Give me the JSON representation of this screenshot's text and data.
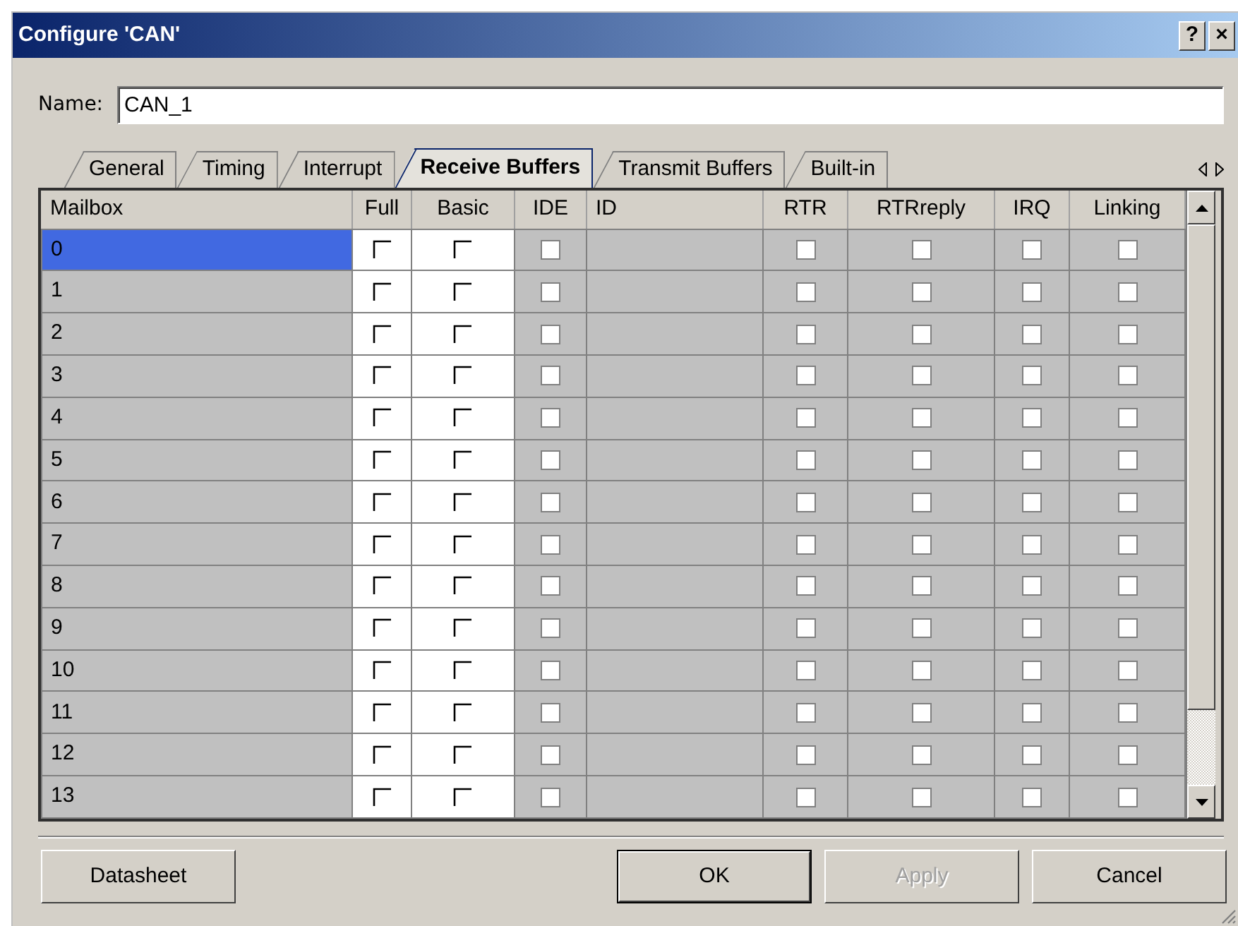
{
  "window": {
    "title": "Configure 'CAN'",
    "help_button": "?",
    "close_button": "×"
  },
  "name_field": {
    "label": "Name:",
    "value": "CAN_1"
  },
  "tabs": [
    {
      "label": "General",
      "selected": false
    },
    {
      "label": "Timing",
      "selected": false
    },
    {
      "label": "Interrupt",
      "selected": false
    },
    {
      "label": "Receive Buffers",
      "selected": true
    },
    {
      "label": "Transmit Buffers",
      "selected": false
    },
    {
      "label": "Built-in",
      "selected": false
    }
  ],
  "table": {
    "columns": [
      {
        "label": "Mailbox",
        "kind": "name"
      },
      {
        "label": "Full",
        "kind": "check",
        "enabled": true
      },
      {
        "label": "Basic",
        "kind": "check",
        "enabled": true
      },
      {
        "label": "IDE",
        "kind": "check",
        "enabled": false
      },
      {
        "label": "ID",
        "kind": "value"
      },
      {
        "label": "RTR",
        "kind": "check",
        "enabled": false
      },
      {
        "label": "RTRreply",
        "kind": "check",
        "enabled": false
      },
      {
        "label": "IRQ",
        "kind": "check",
        "enabled": false
      },
      {
        "label": "Linking",
        "kind": "check",
        "enabled": false
      }
    ],
    "rows": [
      {
        "mailbox": "0",
        "selected": true,
        "checked": [
          false,
          false,
          false,
          false,
          false,
          false,
          false
        ]
      },
      {
        "mailbox": "1",
        "selected": false,
        "checked": [
          false,
          false,
          false,
          false,
          false,
          false,
          false
        ]
      },
      {
        "mailbox": "2",
        "selected": false,
        "checked": [
          false,
          false,
          false,
          false,
          false,
          false,
          false
        ]
      },
      {
        "mailbox": "3",
        "selected": false,
        "checked": [
          false,
          false,
          false,
          false,
          false,
          false,
          false
        ]
      },
      {
        "mailbox": "4",
        "selected": false,
        "checked": [
          false,
          false,
          false,
          false,
          false,
          false,
          false
        ]
      },
      {
        "mailbox": "5",
        "selected": false,
        "checked": [
          false,
          false,
          false,
          false,
          false,
          false,
          false
        ]
      },
      {
        "mailbox": "6",
        "selected": false,
        "checked": [
          false,
          false,
          false,
          false,
          false,
          false,
          false
        ]
      },
      {
        "mailbox": "7",
        "selected": false,
        "checked": [
          false,
          false,
          false,
          false,
          false,
          false,
          false
        ]
      },
      {
        "mailbox": "8",
        "selected": false,
        "checked": [
          false,
          false,
          false,
          false,
          false,
          false,
          false
        ]
      },
      {
        "mailbox": "9",
        "selected": false,
        "checked": [
          false,
          false,
          false,
          false,
          false,
          false,
          false
        ]
      },
      {
        "mailbox": "10",
        "selected": false,
        "checked": [
          false,
          false,
          false,
          false,
          false,
          false,
          false
        ]
      },
      {
        "mailbox": "11",
        "selected": false,
        "checked": [
          false,
          false,
          false,
          false,
          false,
          false,
          false
        ]
      },
      {
        "mailbox": "12",
        "selected": false,
        "checked": [
          false,
          false,
          false,
          false,
          false,
          false,
          false
        ]
      },
      {
        "mailbox": "13",
        "selected": false,
        "checked": [
          false,
          false,
          false,
          false,
          false,
          false,
          false
        ]
      }
    ]
  },
  "buttons": [
    {
      "label": "Datasheet",
      "kind": "left",
      "disabled": false,
      "default": false
    },
    {
      "label": "OK",
      "kind": "right",
      "disabled": false,
      "default": true
    },
    {
      "label": "Apply",
      "kind": "right",
      "disabled": true,
      "default": false
    },
    {
      "label": "Cancel",
      "kind": "right",
      "disabled": false,
      "default": false
    }
  ]
}
